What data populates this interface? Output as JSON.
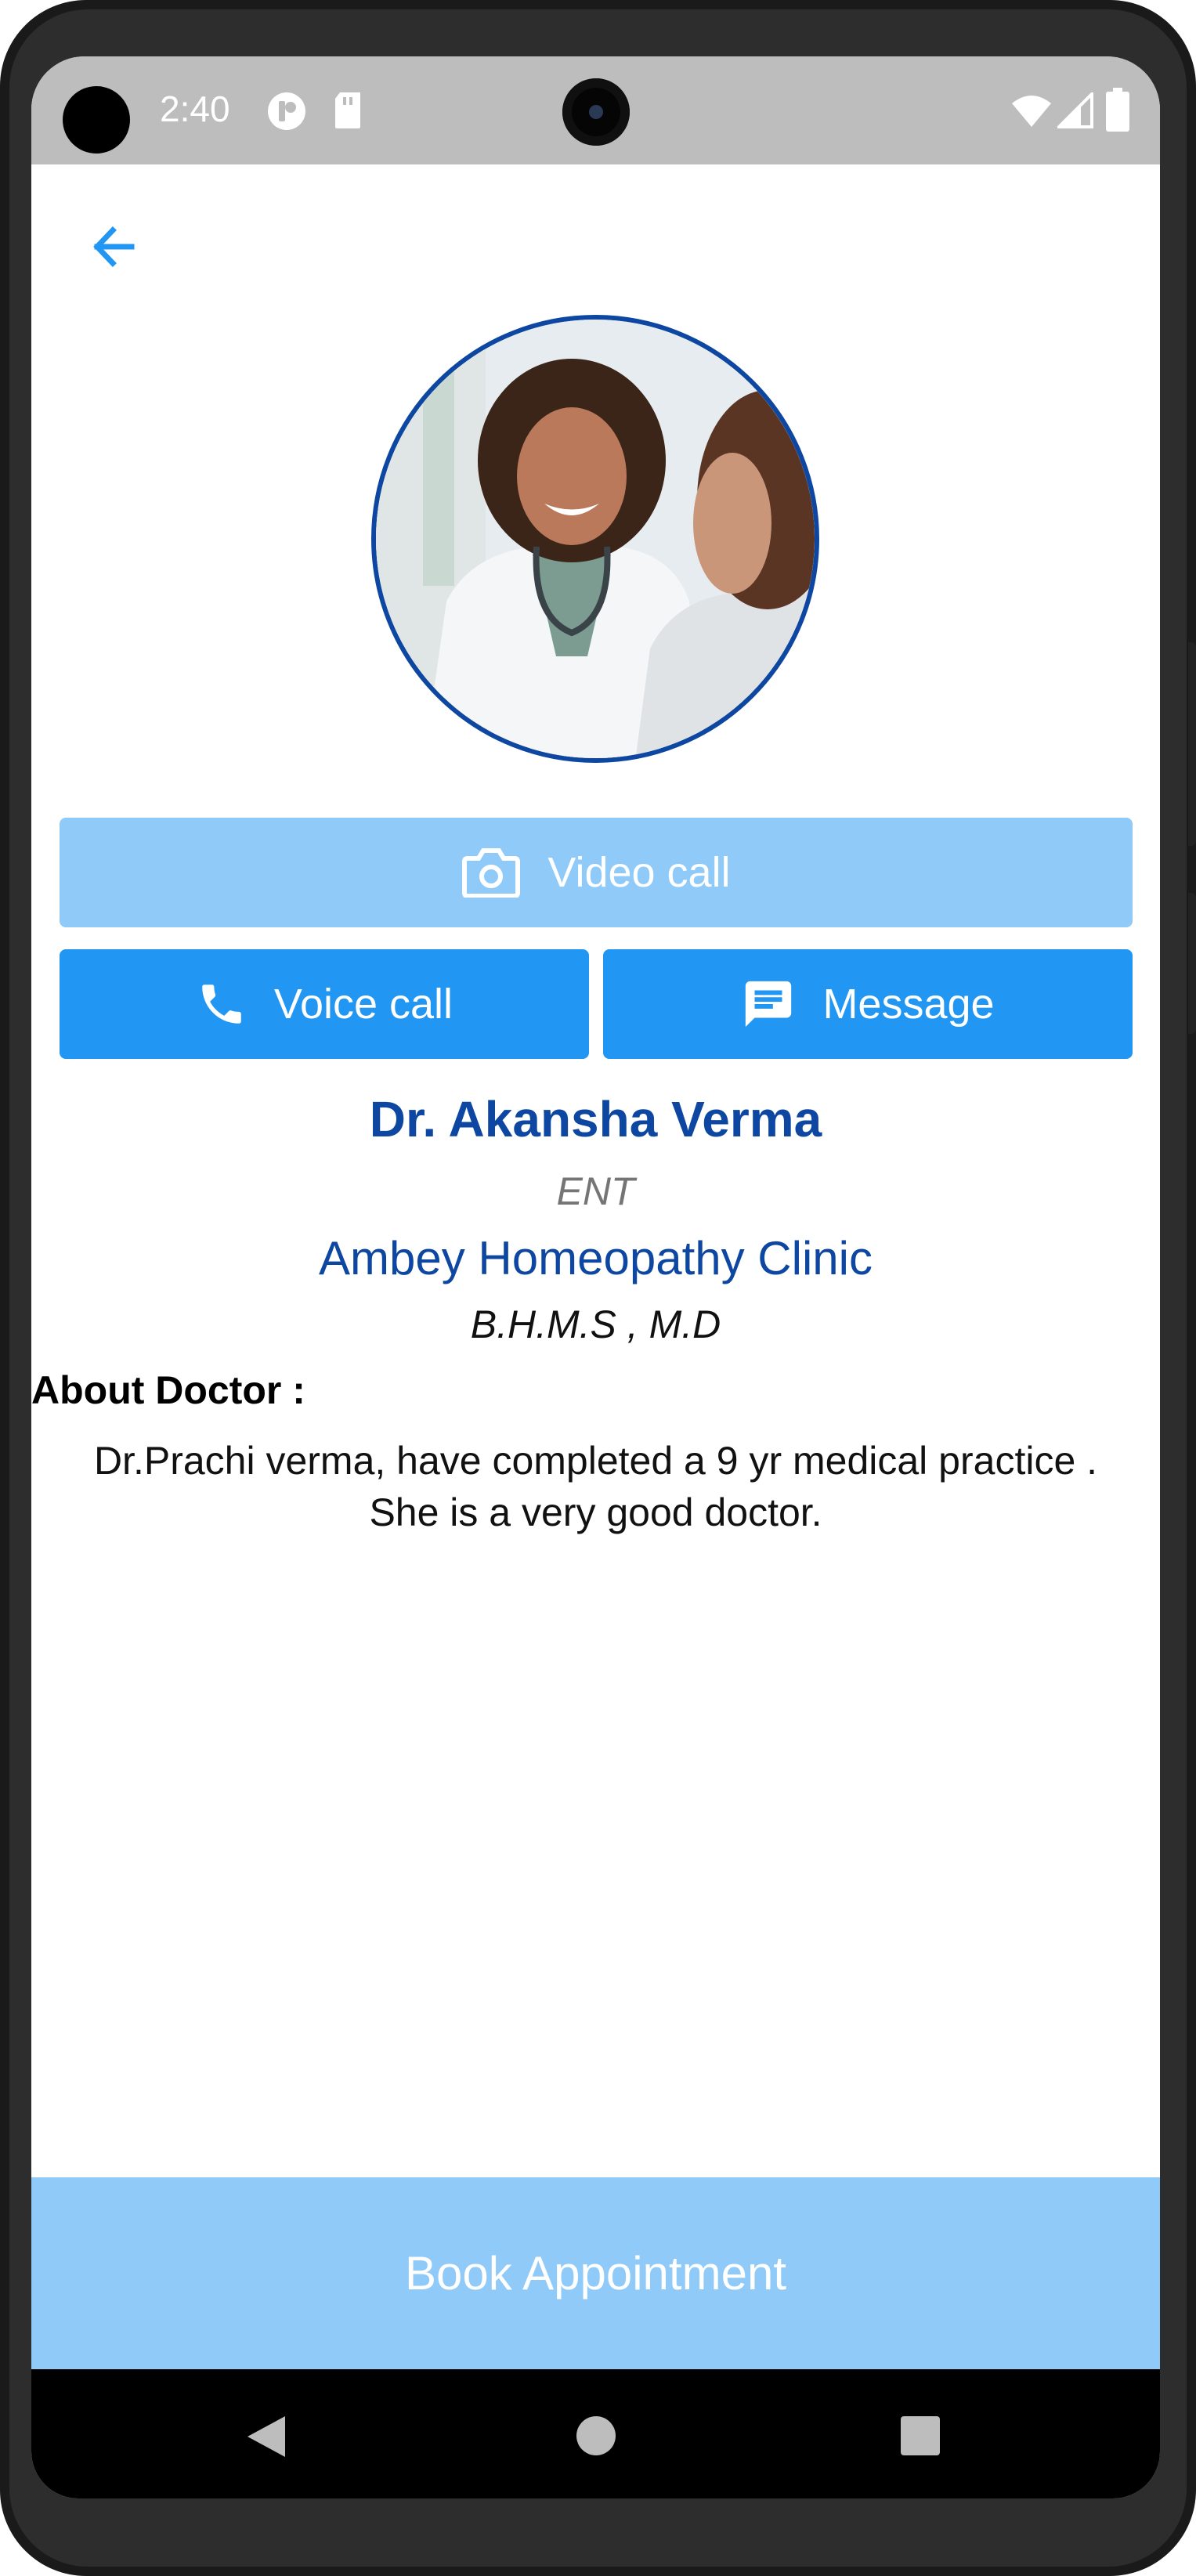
{
  "status_bar": {
    "time": "2:40",
    "icons": [
      "cellular-data-icon",
      "sd-card-icon",
      "wifi-icon",
      "signal-icon",
      "battery-icon"
    ]
  },
  "header": {
    "back_icon": "arrow-left-icon"
  },
  "actions": {
    "video_call_label": "Video call",
    "voice_call_label": "Voice call",
    "message_label": "Message"
  },
  "doctor": {
    "name": "Dr. Akansha Verma",
    "specialty": "ENT",
    "clinic": "Ambey Homeopathy Clinic",
    "degree": "B.H.M.S , M.D",
    "about_label": "About Doctor :",
    "about_line1": "Dr.Prachi verma, have completed a 9 yr medical practice .",
    "about_line2": "She is a very good doctor."
  },
  "footer": {
    "book_label": "Book Appointment"
  },
  "colors": {
    "primary": "#2196f3",
    "primary_light": "#90caf9",
    "accent_dark": "#0d47a1",
    "status_bar": "#bdbdbd"
  }
}
